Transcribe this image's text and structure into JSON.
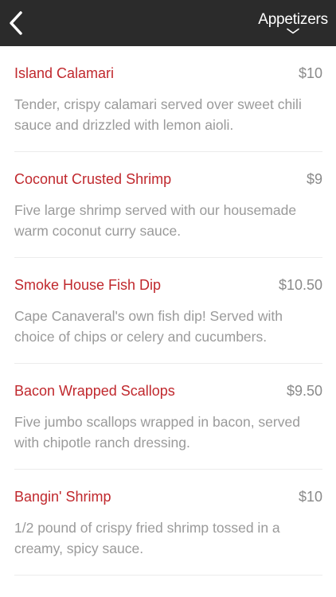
{
  "header": {
    "back_icon": "chevron-left-icon",
    "category_label": "Appetizers",
    "category_icon": "chevron-down-icon"
  },
  "menu": {
    "items": [
      {
        "name": "Island Calamari",
        "price": "$10",
        "description": "Tender, crispy calamari served over sweet chili sauce and drizzled with lemon aioli."
      },
      {
        "name": "Coconut Crusted Shrimp",
        "price": "$9",
        "description": "Five large shrimp served with our housemade warm coconut curry sauce."
      },
      {
        "name": "Smoke House Fish Dip",
        "price": "$10.50",
        "description": "Cape Canaveral's own fish dip! Served with choice of chips or celery and cucumbers."
      },
      {
        "name": "Bacon Wrapped Scallops",
        "price": "$9.50",
        "description": "Five jumbo scallops wrapped in bacon, served with chipotle ranch dressing."
      },
      {
        "name": "Bangin' Shrimp",
        "price": "$10",
        "description": "1/2 pound of crispy fried shrimp tossed in a creamy, spicy sauce."
      }
    ]
  },
  "colors": {
    "header_background": "#2b2b2b",
    "item_name": "#c0282d",
    "item_price": "#8a8a8a",
    "item_description": "#9a9a9a"
  }
}
